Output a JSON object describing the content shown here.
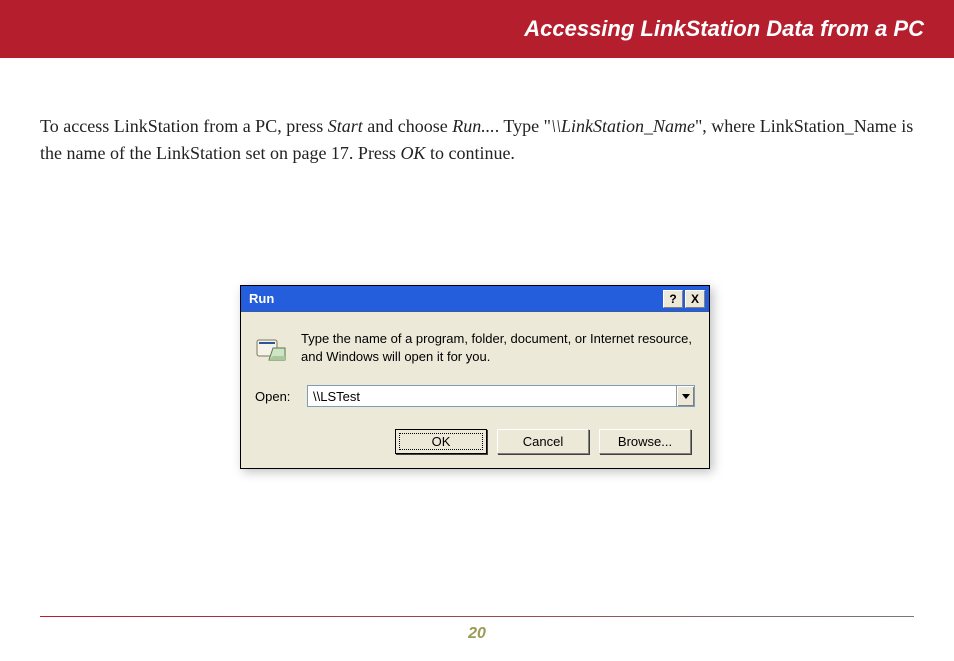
{
  "header": {
    "title": "Accessing LinkStation Data from a PC"
  },
  "body": {
    "pre1": "To access LinkStation from a PC, press ",
    "em1": "Start",
    "mid1": " and choose ",
    "em2": "Run...",
    "mid2": ".  Type \"",
    "em3": "\\\\LinkStation_Name",
    "mid3": "\", where LinkStation_Name is the name of the LinkStation set on page 17.  Press ",
    "em4": "OK",
    "post": " to continue."
  },
  "dialog": {
    "title": "Run",
    "help_glyph": "?",
    "close_glyph": "X",
    "instruction": "Type the name of a program, folder, document, or Internet resource, and Windows will open it for you.",
    "open_label": "Open:",
    "open_value": "\\\\LSTest",
    "buttons": {
      "ok": "OK",
      "cancel": "Cancel",
      "browse": "Browse..."
    }
  },
  "footer": {
    "page": "20"
  }
}
